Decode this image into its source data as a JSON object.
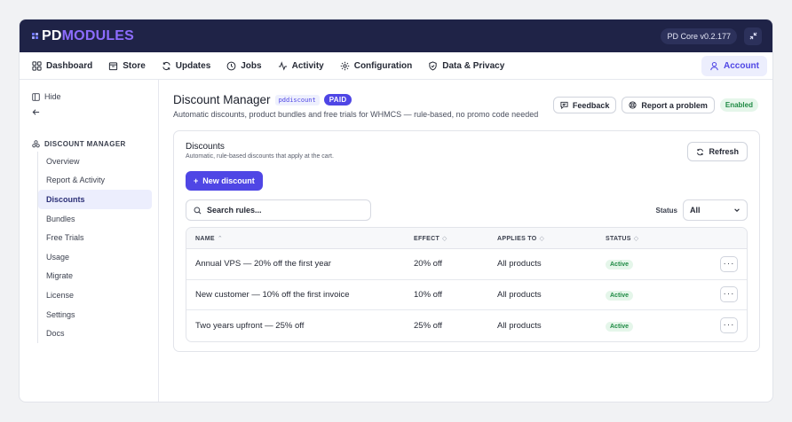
{
  "brand": {
    "pd": "PD",
    "modules": "MODULES"
  },
  "version": "PD Core v0.2.177",
  "nav": {
    "items": [
      {
        "label": "Dashboard",
        "icon": "grid-icon"
      },
      {
        "label": "Store",
        "icon": "store-icon"
      },
      {
        "label": "Updates",
        "icon": "refresh-icon"
      },
      {
        "label": "Jobs",
        "icon": "clock-icon"
      },
      {
        "label": "Activity",
        "icon": "activity-icon"
      },
      {
        "label": "Configuration",
        "icon": "gear-icon"
      },
      {
        "label": "Data & Privacy",
        "icon": "shield-icon"
      }
    ],
    "account": "Account"
  },
  "sidebar": {
    "hide": "Hide",
    "section": "DISCOUNT MANAGER",
    "items": [
      "Overview",
      "Report & Activity",
      "Discounts",
      "Bundles",
      "Free Trials",
      "Usage",
      "Migrate",
      "License",
      "Settings",
      "Docs"
    ],
    "active": "Discounts"
  },
  "page": {
    "title": "Discount Manager",
    "code": "pddiscount",
    "badge": "PAID",
    "subtitle": "Automatic discounts, product bundles and free trials for WHMCS — rule-based, no promo code needed",
    "feedback": "Feedback",
    "report": "Report a problem",
    "status": "Enabled"
  },
  "card": {
    "title": "Discounts",
    "subtitle": "Automatic, rule-based discounts that apply at the cart.",
    "refresh": "Refresh",
    "new_button": "New discount",
    "search_placeholder": "Search rules...",
    "status_label": "Status",
    "status_value": "All"
  },
  "table": {
    "headers": {
      "name": "NAME",
      "effect": "EFFECT",
      "applies": "APPLIES TO",
      "status": "STATUS"
    },
    "rows": [
      {
        "name": "Annual VPS — 20% off the first year",
        "effect": "20% off",
        "applies": "All products",
        "status": "Active"
      },
      {
        "name": "New customer — 10% off the first invoice",
        "effect": "10% off",
        "applies": "All products",
        "status": "Active"
      },
      {
        "name": "Two years upfront — 25% off",
        "effect": "25% off",
        "applies": "All products",
        "status": "Active"
      }
    ]
  },
  "colors": {
    "topbar": "#1f2347",
    "accent": "#4f46e5",
    "success": "#1f8a44"
  }
}
